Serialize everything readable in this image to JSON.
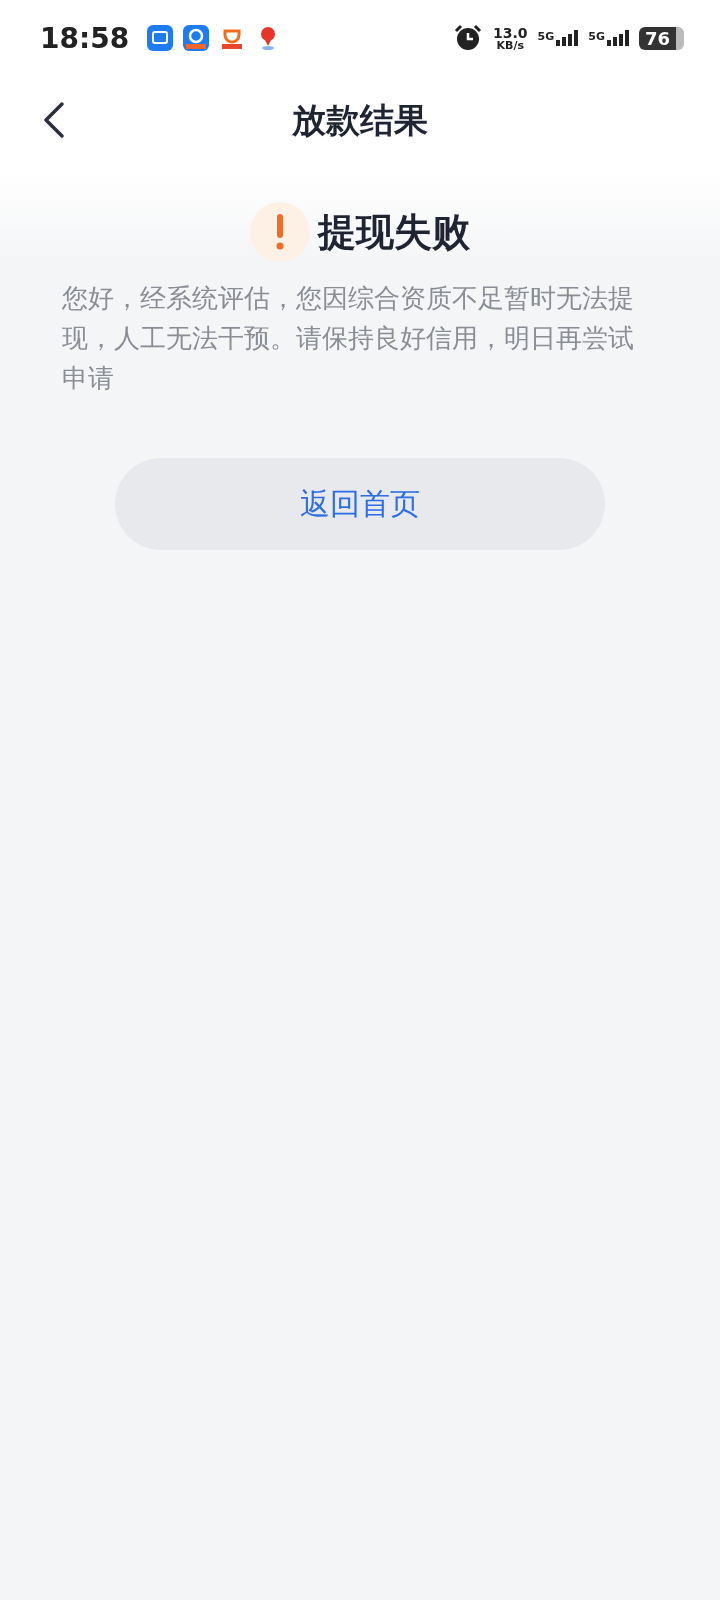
{
  "status_bar": {
    "time": "18:58",
    "speed_value": "13.0",
    "speed_unit": "KB/s",
    "signals": [
      {
        "label": "5G"
      },
      {
        "label": "5G"
      }
    ],
    "battery": "76"
  },
  "header": {
    "title": "放款结果"
  },
  "result": {
    "title": "提现失败",
    "message": "您好，经系统评估，您因综合资质不足暂时无法提现，人工无法干预。请保持良好信用，明日再尝试申请"
  },
  "button": {
    "label": "返回首页"
  }
}
